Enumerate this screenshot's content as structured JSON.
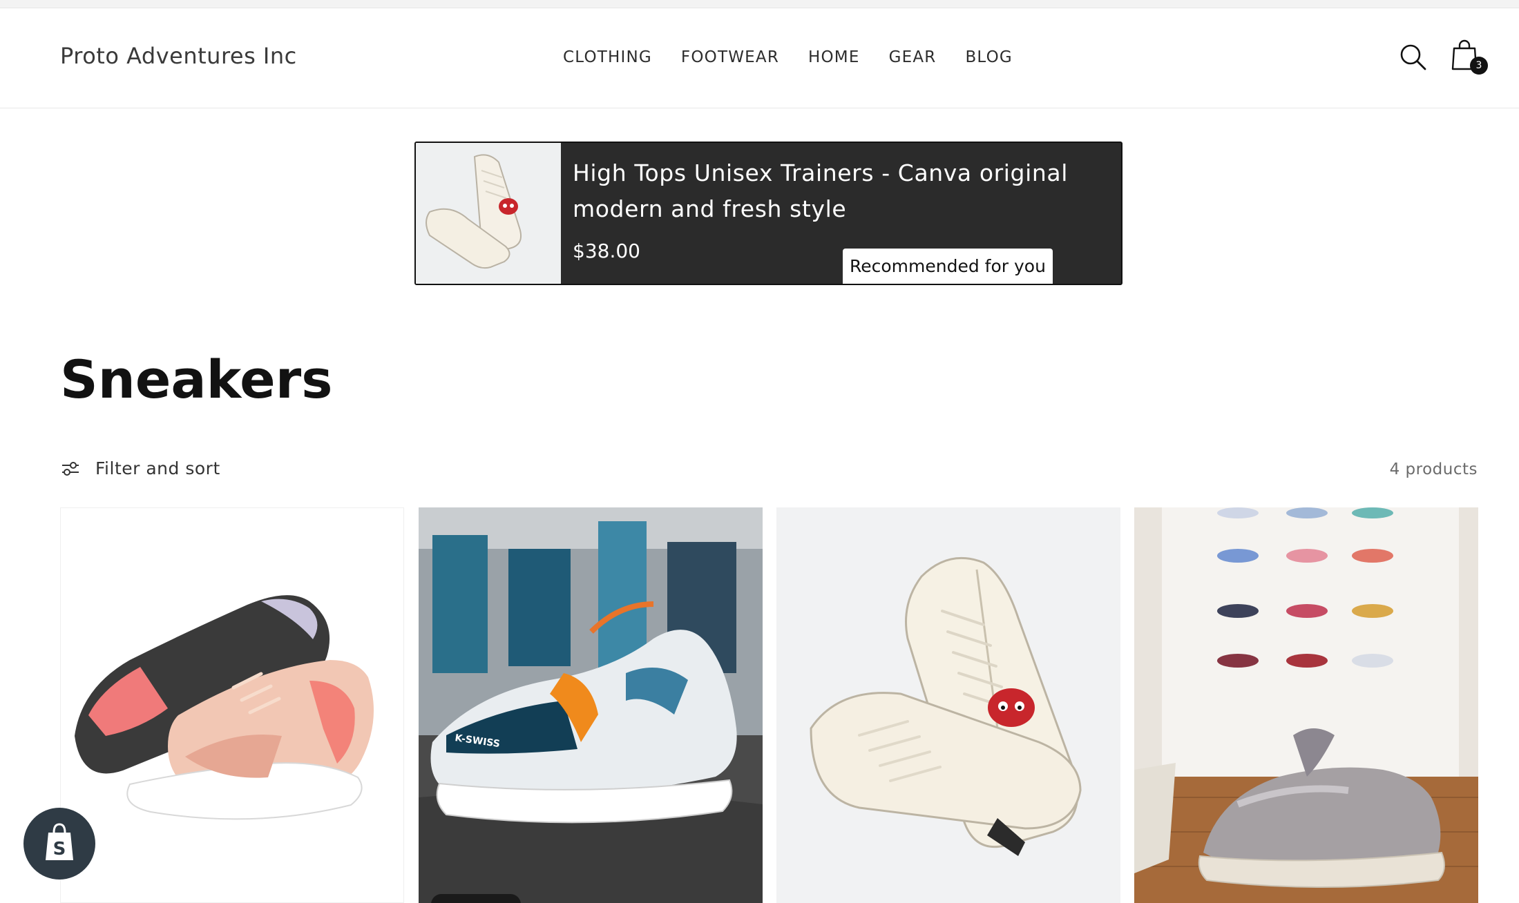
{
  "header": {
    "brand": "Proto Adventures Inc",
    "nav": [
      "CLOTHING",
      "FOOTWEAR",
      "HOME",
      "GEAR",
      "BLOG"
    ],
    "search_icon": "search-icon",
    "cart_icon": "shopping-bag-icon",
    "cart_count": "3"
  },
  "recommendation": {
    "title": "High Tops Unisex Trainers - Canva original modern and fresh style",
    "price": "$38.00",
    "badge": "Recommended for you"
  },
  "collection": {
    "title": "Sneakers",
    "filter_label": "Filter and sort",
    "filter_icon": "sliders-icon",
    "count": "4 products"
  },
  "products": [
    {
      "image": "pink-running-sneaker-image"
    },
    {
      "image": "kswiss-sneaker-street-image",
      "brand_text": "K-SWISS"
    },
    {
      "image": "white-high-top-sneakers-image"
    },
    {
      "image": "grey-chunky-sneaker-floor-image"
    }
  ],
  "fab": {
    "icon": "shopify-bag-icon"
  },
  "colors": {
    "rec_bg": "#2b2b2b",
    "text": "#121212",
    "muted": "#6b6b6b"
  }
}
